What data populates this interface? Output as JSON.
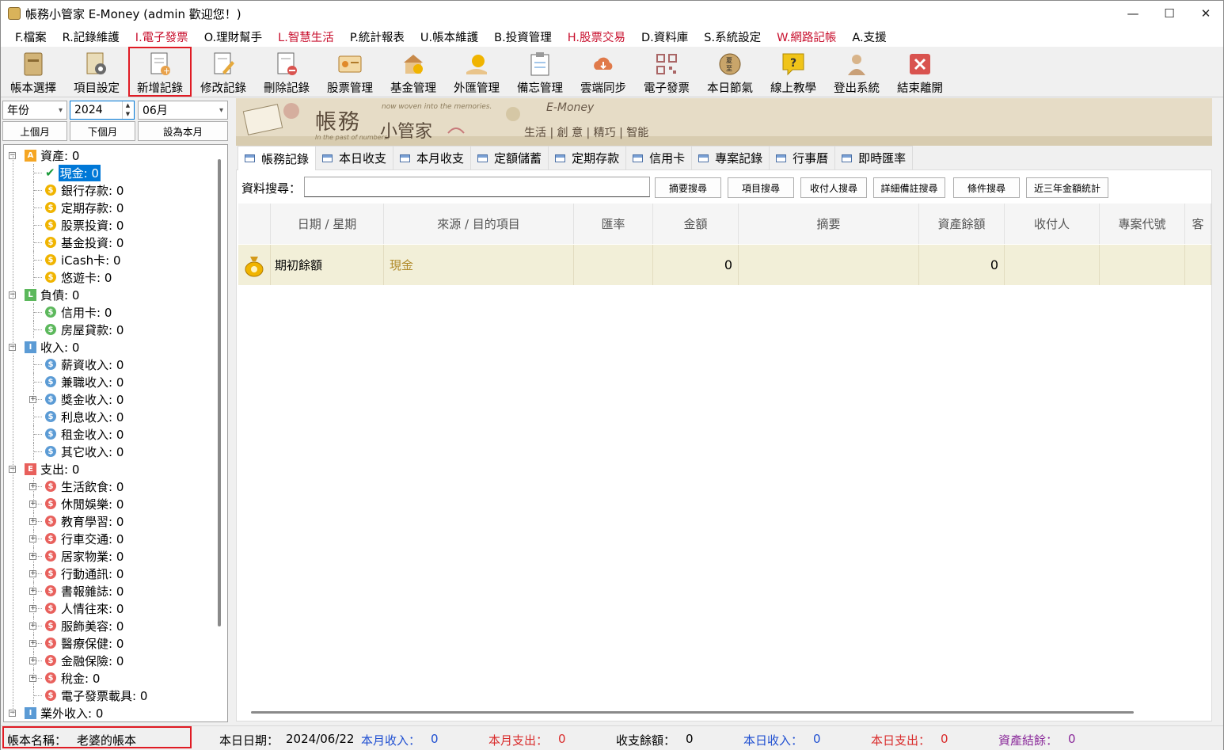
{
  "window": {
    "title": "帳務小管家 E-Money (admin 歡迎您！)",
    "minimize": "—",
    "maximize": "☐",
    "close": "✕"
  },
  "menu": [
    "F.檔案",
    "R.記錄維護",
    "I.電子發票",
    "O.理財幫手",
    "L.智慧生活",
    "P.統計報表",
    "U.帳本維護",
    "B.投資管理",
    "H.股票交易",
    "D.資料庫",
    "S.系統設定",
    "W.網路記帳",
    "A.支援"
  ],
  "menu_red": [
    false,
    false,
    true,
    false,
    true,
    false,
    false,
    false,
    true,
    false,
    false,
    true,
    false
  ],
  "toolbar": [
    {
      "label": "帳本選擇",
      "icon": "ledger-icon"
    },
    {
      "label": "項目設定",
      "icon": "gear-doc-icon"
    },
    {
      "label": "新增記錄",
      "icon": "add-record-icon"
    },
    {
      "label": "修改記錄",
      "icon": "edit-record-icon"
    },
    {
      "label": "刪除記錄",
      "icon": "delete-record-icon"
    },
    {
      "label": "股票管理",
      "icon": "stock-icon"
    },
    {
      "label": "基金管理",
      "icon": "fund-icon"
    },
    {
      "label": "外匯管理",
      "icon": "forex-icon"
    },
    {
      "label": "備忘管理",
      "icon": "memo-icon"
    },
    {
      "label": "雲端同步",
      "icon": "cloud-sync-icon"
    },
    {
      "label": "電子發票",
      "icon": "qr-icon"
    },
    {
      "label": "本日節氣",
      "icon": "solar-term-icon"
    },
    {
      "label": "線上教學",
      "icon": "help-icon"
    },
    {
      "label": "登出系統",
      "icon": "logout-icon"
    },
    {
      "label": "結束離開",
      "icon": "exit-icon"
    }
  ],
  "filters": {
    "year_mode": "年份",
    "year": "2024",
    "month": "06月",
    "prev": "上個月",
    "next": "下個月",
    "set_current": "設為本月"
  },
  "tree": [
    {
      "label": "資產: 0",
      "level": 0,
      "type": "A",
      "color": "#f5a623"
    },
    {
      "label": "現金: 0",
      "level": 1,
      "type": "check",
      "selected": true
    },
    {
      "label": "銀行存款: 0",
      "level": 1,
      "type": "coin",
      "color": "#f0b400"
    },
    {
      "label": "定期存款: 0",
      "level": 1,
      "type": "coin",
      "color": "#f0b400"
    },
    {
      "label": "股票投資: 0",
      "level": 1,
      "type": "coin",
      "color": "#f0b400"
    },
    {
      "label": "基金投資: 0",
      "level": 1,
      "type": "coin",
      "color": "#f0b400"
    },
    {
      "label": "iCash卡: 0",
      "level": 1,
      "type": "coin",
      "color": "#f0b400"
    },
    {
      "label": "悠遊卡: 0",
      "level": 1,
      "type": "coin",
      "color": "#f0b400"
    },
    {
      "label": "負債: 0",
      "level": 0,
      "type": "L",
      "color": "#5cb85c"
    },
    {
      "label": "信用卡: 0",
      "level": 1,
      "type": "coin",
      "color": "#5cb85c"
    },
    {
      "label": "房屋貸款: 0",
      "level": 1,
      "type": "coin",
      "color": "#5cb85c"
    },
    {
      "label": "收入: 0",
      "level": 0,
      "type": "I",
      "color": "#5b9bd5"
    },
    {
      "label": "薪資收入: 0",
      "level": 1,
      "type": "coin",
      "color": "#5b9bd5"
    },
    {
      "label": "兼職收入: 0",
      "level": 1,
      "type": "coin",
      "color": "#5b9bd5"
    },
    {
      "label": "獎金收入: 0",
      "level": 1,
      "type": "coin",
      "color": "#5b9bd5",
      "plus": true
    },
    {
      "label": "利息收入: 0",
      "level": 1,
      "type": "coin",
      "color": "#5b9bd5"
    },
    {
      "label": "租金收入: 0",
      "level": 1,
      "type": "coin",
      "color": "#5b9bd5"
    },
    {
      "label": "其它收入: 0",
      "level": 1,
      "type": "coin",
      "color": "#5b9bd5"
    },
    {
      "label": "支出: 0",
      "level": 0,
      "type": "E",
      "color": "#e8605c"
    },
    {
      "label": "生活飲食: 0",
      "level": 1,
      "type": "coin",
      "color": "#e8605c",
      "plus": true
    },
    {
      "label": "休閒娛樂: 0",
      "level": 1,
      "type": "coin",
      "color": "#e8605c",
      "plus": true
    },
    {
      "label": "教育學習: 0",
      "level": 1,
      "type": "coin",
      "color": "#e8605c",
      "plus": true
    },
    {
      "label": "行車交通: 0",
      "level": 1,
      "type": "coin",
      "color": "#e8605c",
      "plus": true
    },
    {
      "label": "居家物業: 0",
      "level": 1,
      "type": "coin",
      "color": "#e8605c",
      "plus": true
    },
    {
      "label": "行動通訊: 0",
      "level": 1,
      "type": "coin",
      "color": "#e8605c",
      "plus": true
    },
    {
      "label": "書報雜誌: 0",
      "level": 1,
      "type": "coin",
      "color": "#e8605c",
      "plus": true
    },
    {
      "label": "人情往來: 0",
      "level": 1,
      "type": "coin",
      "color": "#e8605c",
      "plus": true
    },
    {
      "label": "服飾美容: 0",
      "level": 1,
      "type": "coin",
      "color": "#e8605c",
      "plus": true
    },
    {
      "label": "醫療保健: 0",
      "level": 1,
      "type": "coin",
      "color": "#e8605c",
      "plus": true
    },
    {
      "label": "金融保險: 0",
      "level": 1,
      "type": "coin",
      "color": "#e8605c",
      "plus": true
    },
    {
      "label": "稅金: 0",
      "level": 1,
      "type": "coin",
      "color": "#e8605c",
      "plus": true
    },
    {
      "label": "電子發票載具: 0",
      "level": 1,
      "type": "coin",
      "color": "#e8605c"
    },
    {
      "label": "業外收入: 0",
      "level": 0,
      "type": "I",
      "color": "#5b9bd5"
    }
  ],
  "banner": {
    "tagline_top": "now woven into the memories.",
    "tagline_bottom": "In the past of numbers.",
    "brand1": "帳務",
    "brand2": "小管家",
    "emoney": "E-Money",
    "slogan": "生活 | 創 意 | 精巧 | 智能"
  },
  "tabs": [
    "帳務記錄",
    "本日收支",
    "本月收支",
    "定額儲蓄",
    "定期存款",
    "信用卡",
    "專案記錄",
    "行事曆",
    "即時匯率"
  ],
  "search": {
    "label": "資料搜尋：",
    "value": "",
    "buttons": [
      "摘要搜尋",
      "項目搜尋",
      "收付人搜尋",
      "詳細備註搜尋",
      "條件搜尋",
      "近三年金額統計"
    ]
  },
  "grid": {
    "headers": [
      "日期 / 星期",
      "來源 / 目的項目",
      "匯率",
      "金額",
      "摘要",
      "資產餘額",
      "收付人",
      "專案代號",
      "客"
    ],
    "rows": [
      {
        "date": "期初餘額",
        "item": "現金",
        "rate": "",
        "amount": "0",
        "memo": "",
        "balance": "0",
        "payee": "",
        "project": ""
      }
    ]
  },
  "status": {
    "book_label": "帳本名稱：",
    "book_name": "老婆的帳本",
    "today_label": "本日日期：",
    "today": "2024/06/22",
    "month_income_label": "本月收入：",
    "month_income": "0",
    "month_expense_label": "本月支出：",
    "month_expense": "0",
    "balance_label": "收支餘額：",
    "balance": "0",
    "day_income_label": "本日收入：",
    "day_income": "0",
    "day_expense_label": "本日支出：",
    "day_expense": "0",
    "asset_label": "資產結餘：",
    "asset": "0"
  },
  "colors": {
    "accent_red": "#c8102e",
    "income_blue": "#1f4fd1",
    "expense_red": "#d92c2c",
    "asset_purple": "#8a2a9a",
    "highlight": "#e01b24",
    "selected_bg": "#0078d7"
  }
}
